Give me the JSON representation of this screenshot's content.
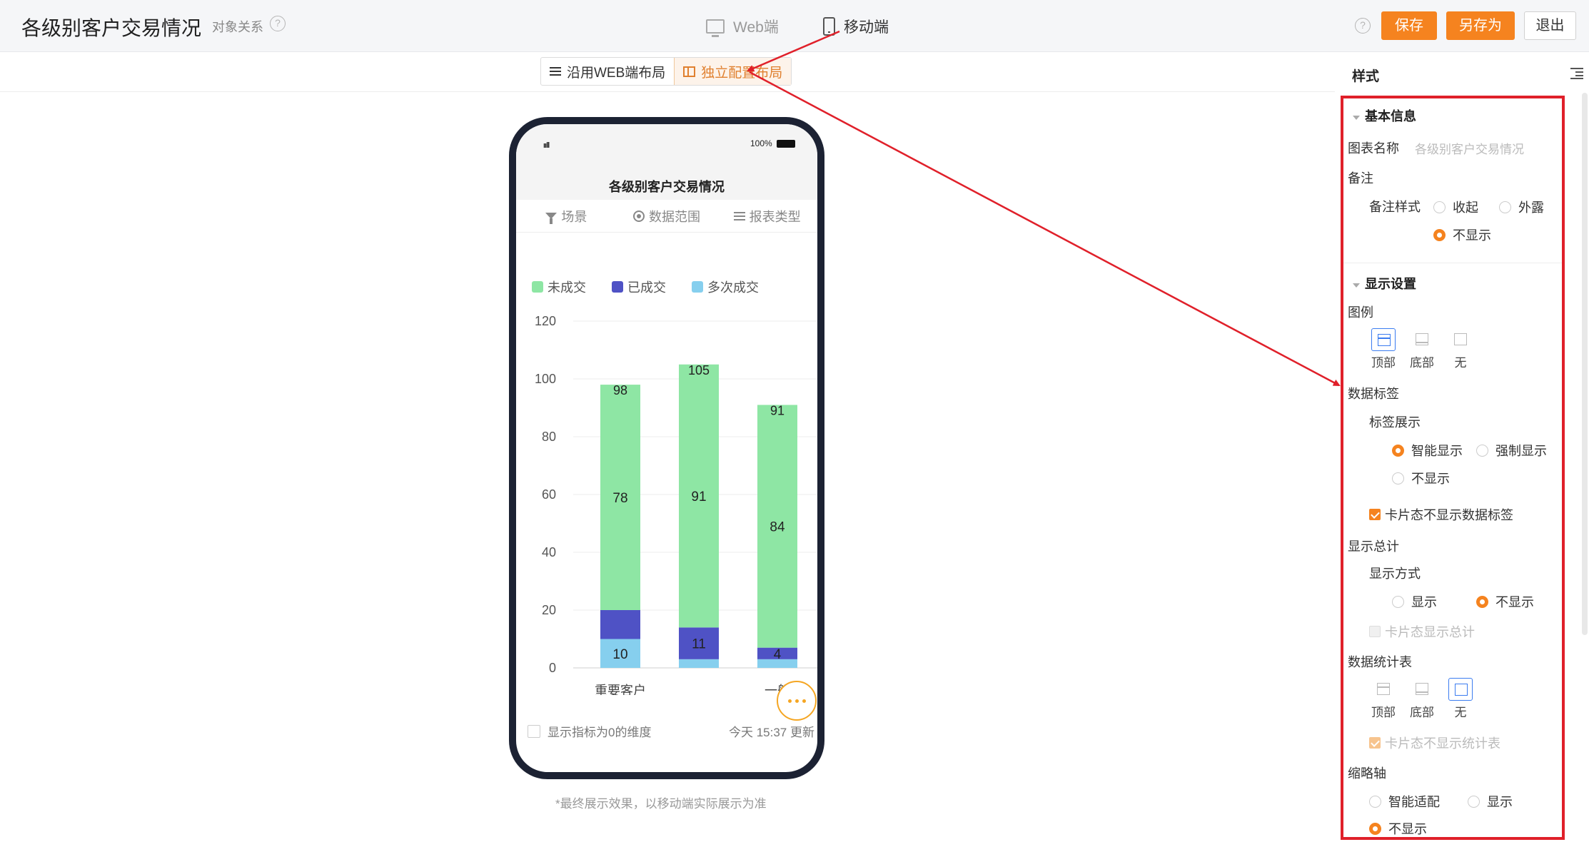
{
  "header": {
    "title": "各级别客户交易情况",
    "subtitle": "对象关系",
    "help_glyph": "?",
    "modes": {
      "web": "Web端",
      "mobile": "移动端"
    },
    "buttons": {
      "save": "保存",
      "save_as": "另存为",
      "exit": "退出"
    }
  },
  "layout_toggle": {
    "inherit": "沿用WEB端布局",
    "independent": "独立配置布局",
    "selected": "independent"
  },
  "phone": {
    "status_signal": "ııll",
    "battery_text": "100%",
    "title": "各级别客户交易情况",
    "filters": [
      "场景",
      "数据范围",
      "报表类型"
    ],
    "legend": [
      "未成交",
      "已成交",
      "多次成交"
    ],
    "footer_checkbox": "显示指标为0的维度",
    "footer_update": "今天 15:37 更新"
  },
  "footnote": "*最终展示效果，以移动端实际展示为准",
  "chart_data": {
    "type": "bar",
    "stacked": true,
    "categories": [
      "重要客户",
      "",
      "一般"
    ],
    "series": [
      {
        "name": "多次成交",
        "values": [
          10,
          3,
          3
        ],
        "color": "#86cfee"
      },
      {
        "name": "已成交",
        "values": [
          10,
          11,
          4
        ],
        "color": "#4f52c5"
      },
      {
        "name": "未成交",
        "values": [
          78,
          91,
          84
        ],
        "color": "#8ee6a4"
      }
    ],
    "totals": [
      98,
      105,
      91
    ],
    "data_labels": [
      {
        "category": 0,
        "series": "多次成交",
        "text": "10"
      },
      {
        "category": 0,
        "series": "未成交",
        "text": "78"
      },
      {
        "category": 1,
        "series": "已成交",
        "text": "11"
      },
      {
        "category": 1,
        "series": "未成交",
        "text": "91"
      },
      {
        "category": 2,
        "series": "已成交",
        "text": "4"
      },
      {
        "category": 2,
        "series": "未成交",
        "text": "84"
      }
    ],
    "yticks": [
      0,
      20,
      40,
      60,
      80,
      100,
      120
    ],
    "ylim": [
      0,
      120
    ],
    "grid": true,
    "legend_position": "top"
  },
  "panel": {
    "title": "样式",
    "basic": {
      "title": "基本信息",
      "chart_name_label": "图表名称",
      "chart_name_placeholder": "各级别客户交易情况",
      "note_label": "备注",
      "note_style_label": "备注样式",
      "note_options": [
        "收起",
        "外露",
        "不显示"
      ],
      "note_selected": "不显示"
    },
    "display": {
      "title": "显示设置",
      "legend_label": "图例",
      "legend_options": [
        "顶部",
        "底部",
        "无"
      ],
      "legend_selected": "顶部",
      "data_label_label": "数据标签",
      "label_display_label": "标签展示",
      "label_options": [
        "智能显示",
        "强制显示",
        "不显示"
      ],
      "label_selected": "智能显示",
      "card_hide_labels": "卡片态不显示数据标签",
      "card_hide_labels_checked": true,
      "total_label": "显示总计",
      "total_mode_label": "显示方式",
      "total_options": [
        "显示",
        "不显示"
      ],
      "total_selected": "不显示",
      "card_show_total": "卡片态显示总计",
      "stat_table_label": "数据统计表",
      "stat_options": [
        "顶部",
        "底部",
        "无"
      ],
      "stat_selected": "无",
      "card_hide_stat": "卡片态不显示统计表",
      "axis_label": "缩略轴",
      "axis_options": [
        "智能适配",
        "显示",
        "不显示"
      ],
      "axis_selected": "不显示"
    }
  },
  "colors": {
    "accent": "#f5831f",
    "annotation": "#e0202a",
    "selected_blue": "#3b7cf0"
  }
}
